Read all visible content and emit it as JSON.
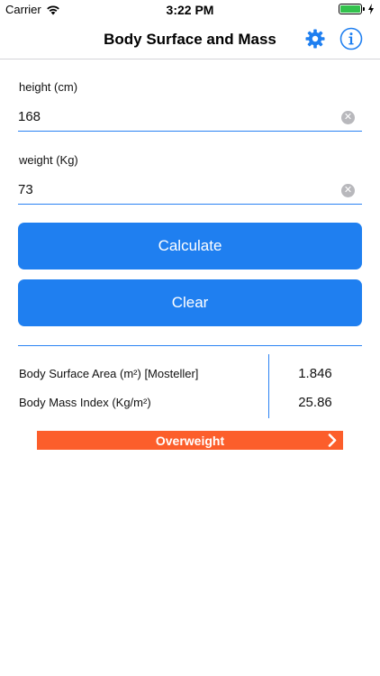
{
  "status_bar": {
    "carrier": "Carrier",
    "time": "3:22 PM",
    "battery_level": 1.0,
    "battery_color": "#33c24d"
  },
  "nav": {
    "title": "Body Surface and Mass",
    "settings_icon": "gear-icon",
    "info_icon": "info-icon",
    "accent_color": "#1f7ff0"
  },
  "form": {
    "height": {
      "label": "height (cm)",
      "value": "168"
    },
    "weight": {
      "label": "weight (Kg)",
      "value": "73"
    },
    "clear_icon": "x-circle-icon"
  },
  "buttons": {
    "calculate": "Calculate",
    "clear": "Clear"
  },
  "results": [
    {
      "label": "Body Surface Area (m²) [Mosteller]",
      "value": "1.846"
    },
    {
      "label": "Body Mass Index (Kg/m²)",
      "value": "25.86"
    }
  ],
  "bmi_category": {
    "label": "Overweight",
    "color": "#fc5e2b",
    "icon": "chevron-right-icon"
  }
}
